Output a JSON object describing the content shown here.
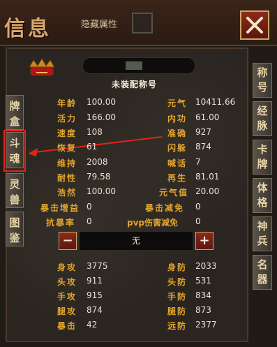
{
  "window": {
    "title": "信息",
    "hidden_attr_label": "隐藏属性",
    "subtitle": "未装配称号"
  },
  "left_tabs": [
    {
      "label": "牌盒"
    },
    {
      "label": "斗魂"
    },
    {
      "label": "灵兽"
    },
    {
      "label": "图鉴"
    }
  ],
  "right_tabs": [
    {
      "label": "称号"
    },
    {
      "label": "经脉"
    },
    {
      "label": "卡牌"
    },
    {
      "label": "体格"
    },
    {
      "label": "神兵"
    },
    {
      "label": "名器"
    }
  ],
  "stats_top": [
    {
      "l1": "年龄",
      "v1": "100.00",
      "l2": "元气",
      "v2": "10411.66"
    },
    {
      "l1": "活力",
      "v1": "166.00",
      "l2": "内功",
      "v2": "61.00"
    },
    {
      "l1": "速度",
      "v1": "108",
      "l2": "准确",
      "v2": "927"
    },
    {
      "l1": "恢复",
      "v1": "61",
      "l2": "闪躲",
      "v2": "874"
    },
    {
      "l1": "维持",
      "v1": "2008",
      "l2": "喊话",
      "v2": "7"
    },
    {
      "l1": "耐性",
      "v1": "79.58",
      "l2": "再生",
      "v2": "81.01"
    },
    {
      "l1": "浩然",
      "v1": "100.00",
      "l2": "元气值",
      "v2": "20.00"
    },
    {
      "l1": "暴击增益",
      "v1": "0",
      "l2": "暴击减免",
      "v2": "0"
    },
    {
      "l1": "抗暴率",
      "v1": "0",
      "l2": "pvp伤害减免",
      "v2": "0"
    }
  ],
  "stepper": {
    "minus": "−",
    "value": "无",
    "plus": "+"
  },
  "stats_bottom": [
    {
      "l1": "身攻",
      "v1": "3775",
      "l2": "身防",
      "v2": "2033"
    },
    {
      "l1": "头攻",
      "v1": "911",
      "l2": "头防",
      "v2": "531"
    },
    {
      "l1": "手攻",
      "v1": "915",
      "l2": "手防",
      "v2": "834"
    },
    {
      "l1": "腿攻",
      "v1": "874",
      "l2": "腿防",
      "v2": "873"
    },
    {
      "l1": "暴击",
      "v1": "42",
      "l2": "远防",
      "v2": "2377"
    }
  ],
  "colors": {
    "label": "#e0a32e",
    "value": "#e8e2d6",
    "highlight": "#e0241a"
  }
}
